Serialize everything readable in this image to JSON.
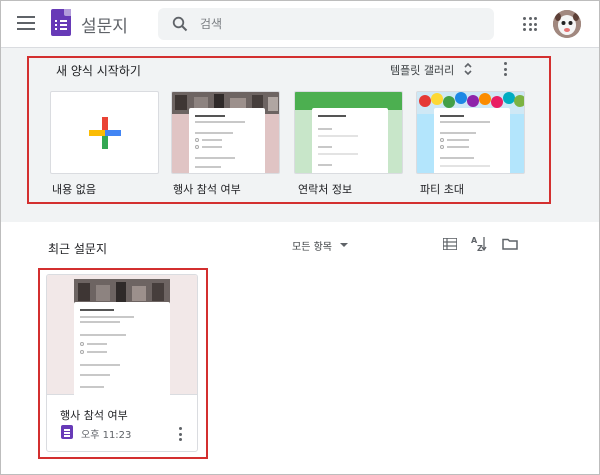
{
  "header": {
    "app_title": "설문지",
    "search_placeholder": "검색"
  },
  "templates": {
    "section_title": "새 양식 시작하기",
    "gallery_label": "템플릿 갤러리",
    "items": [
      {
        "label": "내용 없음"
      },
      {
        "label": "행사 참석 여부"
      },
      {
        "label": "연락처 정보"
      },
      {
        "label": "파티 초대"
      }
    ]
  },
  "recent": {
    "section_title": "최근 설문지",
    "owner_filter": "모든 항목",
    "files": [
      {
        "name": "행사 참석 여부",
        "time": "오후 11:23"
      }
    ]
  },
  "colors": {
    "forms_purple": "#673ab7",
    "highlight_red": "#d32f2f",
    "template_bg": "#f1f3f4"
  }
}
